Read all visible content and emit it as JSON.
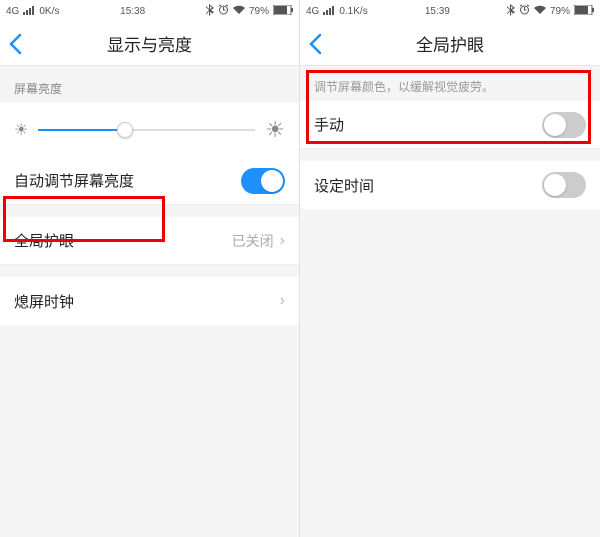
{
  "left": {
    "status": {
      "network": "4G",
      "speed": "0K/s",
      "time": "15:38",
      "battery": "79%"
    },
    "nav": {
      "title": "显示与亮度"
    },
    "brightness_label": "屏幕亮度",
    "auto_brightness": "自动调节屏幕亮度",
    "eye_care": {
      "label": "全局护眼",
      "value": "已关闭"
    },
    "screen_clock": "熄屏时钟"
  },
  "right": {
    "status": {
      "network": "4G",
      "speed": "0.1K/s",
      "time": "15:39",
      "battery": "79%"
    },
    "nav": {
      "title": "全局护眼"
    },
    "hint": "调节屏幕颜色，以缓解视觉疲劳。",
    "manual": "手动",
    "schedule": "设定时间"
  }
}
